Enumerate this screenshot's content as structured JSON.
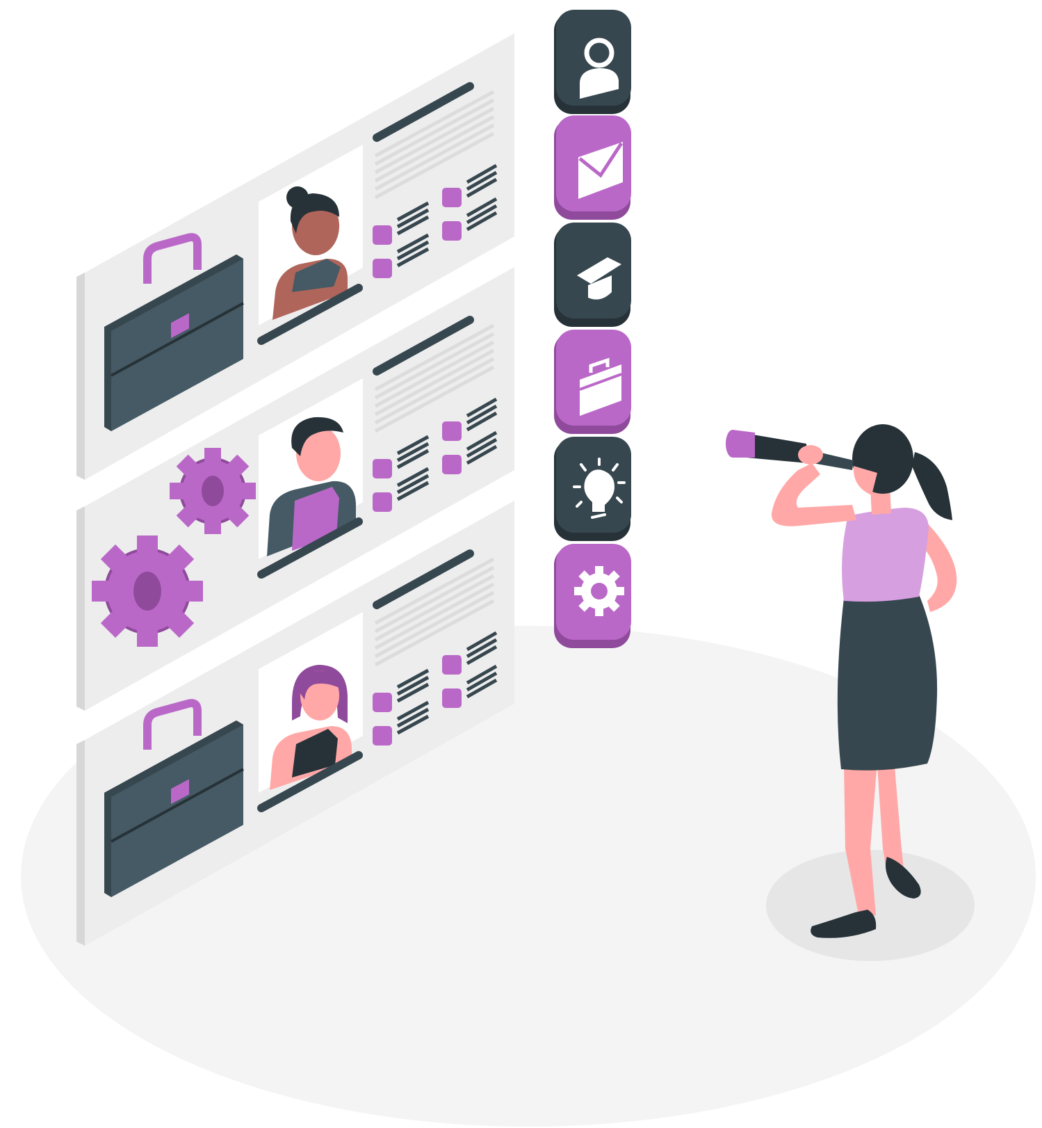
{
  "colors": {
    "background": "#ffffff",
    "floor": "#f4f4f4",
    "floor_shadow": "#e6e6e6",
    "panel": "#ededed",
    "panel_side": "#dadada",
    "dark": "#37474f",
    "dark_deep": "#263238",
    "purple": "#ba68c8",
    "purple_light": "#d69fe0",
    "purple_dark": "#8f4a9c",
    "skin": "#ffa8a7",
    "skin_dark": "#b0655a",
    "white": "#ffffff"
  },
  "illustration": {
    "profile_cards": [
      {
        "portrait": "woman-with-bun-portrait",
        "emblem": "briefcase-icon"
      },
      {
        "portrait": "young-man-portrait",
        "emblem": "gears-icon"
      },
      {
        "portrait": "woman-with-bob-portrait",
        "emblem": "briefcase-icon"
      }
    ],
    "category_tiles": [
      {
        "icon": "user-icon",
        "style": "dark"
      },
      {
        "icon": "envelope-icon",
        "style": "purple"
      },
      {
        "icon": "graduation-cap-icon",
        "style": "dark"
      },
      {
        "icon": "briefcase-icon",
        "style": "purple"
      },
      {
        "icon": "lightbulb-icon",
        "style": "dark"
      },
      {
        "icon": "gear-icon",
        "style": "purple"
      }
    ],
    "figure": "woman-looking-through-telescope"
  }
}
